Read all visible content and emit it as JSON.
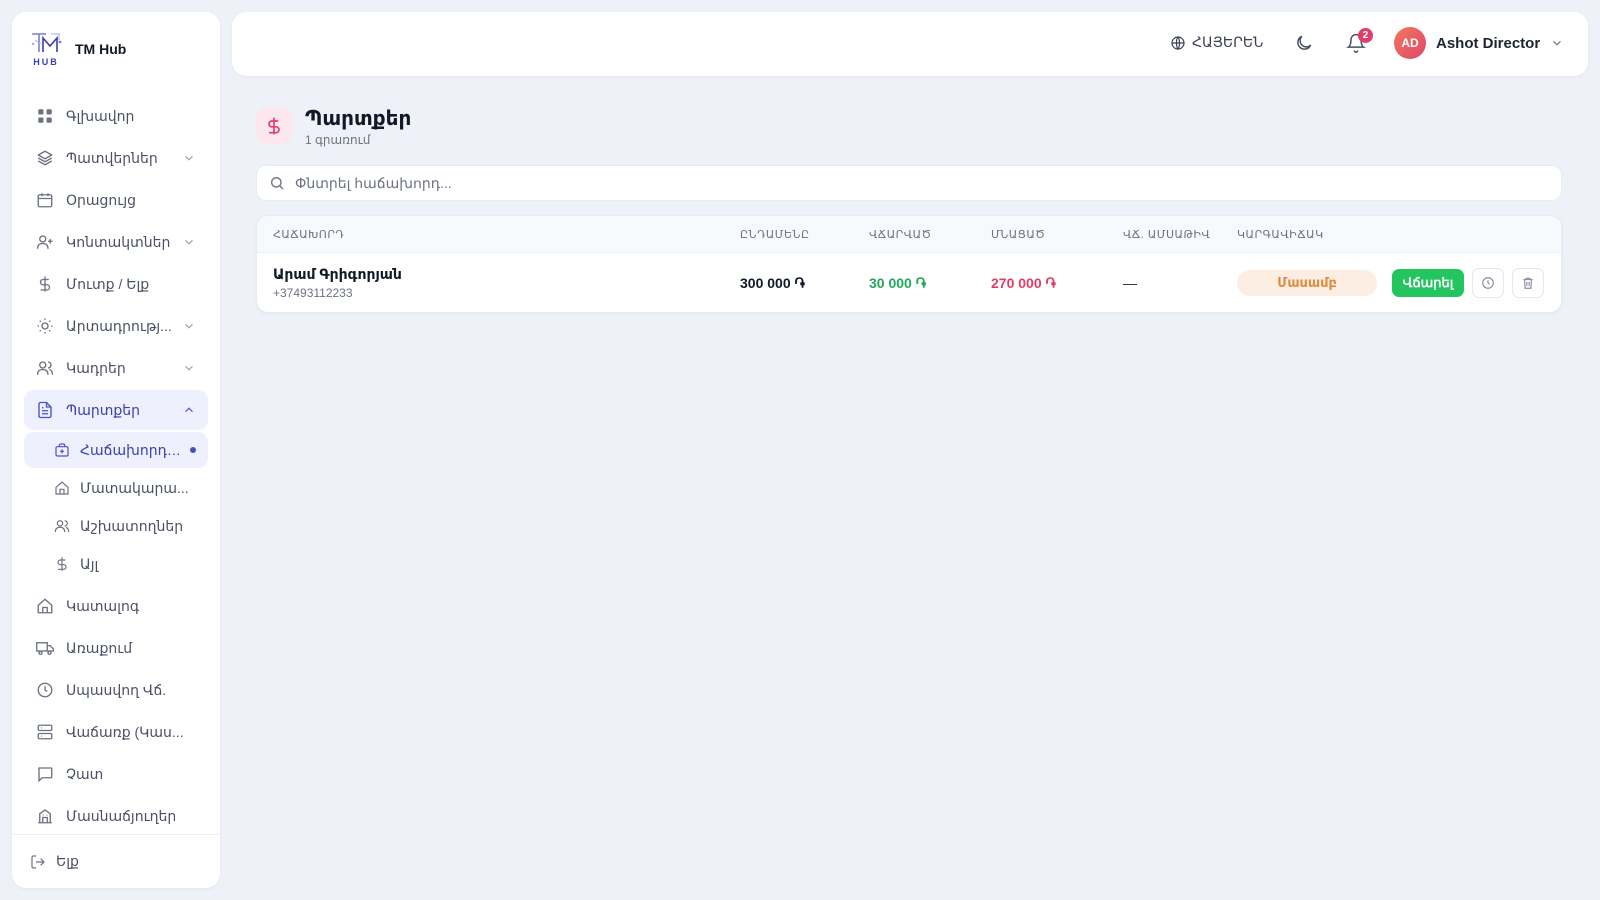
{
  "brand": {
    "logo_text": "HUB",
    "name": "TM Hub"
  },
  "sidebar": {
    "items": [
      {
        "label": "Գլխավոր",
        "icon": "grid-icon"
      },
      {
        "label": "Պատվերներ",
        "icon": "layers-icon"
      },
      {
        "label": "Օրացույց",
        "icon": "calendar-icon"
      },
      {
        "label": "Կոնտակտներ",
        "icon": "user-plus-icon"
      },
      {
        "label": "Մուտք / Ելք",
        "icon": "dollar-icon"
      },
      {
        "label": "Արտադրությ...",
        "icon": "sun-icon"
      },
      {
        "label": "Կադրեր",
        "icon": "users-icon"
      },
      {
        "label": "Պարտքեր",
        "icon": "document-icon"
      }
    ],
    "sub_items": [
      {
        "label": "Հաճախորդներ",
        "icon": "briefcase-icon"
      },
      {
        "label": "Մատակարա...",
        "icon": "home-icon"
      },
      {
        "label": "Աշխատողներ",
        "icon": "users-icon"
      },
      {
        "label": "Այլ",
        "icon": "dollar-icon"
      }
    ],
    "items_after": [
      {
        "label": "Կատալոգ",
        "icon": "home-icon"
      },
      {
        "label": "Առաքում",
        "icon": "truck-icon"
      },
      {
        "label": "Սպասվող Վճ.",
        "icon": "clock-icon"
      },
      {
        "label": "Վաճառք (Կաս...",
        "icon": "server-icon"
      },
      {
        "label": "Չատ",
        "icon": "chat-icon"
      },
      {
        "label": "Մասնաճյուղեր",
        "icon": "building-icon"
      }
    ],
    "logout": "Ելք"
  },
  "topbar": {
    "language": "ՀԱՅԵՐԵՆ",
    "notifications_count": "2",
    "user_initials": "AD",
    "user_name": "Ashot Director"
  },
  "page": {
    "title": "Պարտքեր",
    "subtitle": "1 գրառում"
  },
  "search": {
    "placeholder": "Փնտրել հաճախորդ...",
    "value": ""
  },
  "table": {
    "headers": [
      "ՀԱՃԱԽՈՐԴ",
      "ԸՆԴԱՄԵՆԸ",
      "ՎՃԱՐՎԱԾ",
      "ՄՆԱՑԱԾ",
      "ՎՃ. ԱՄՍԱԹԻՎ",
      "ԿԱՐԳԱՎԻՃԱԿ"
    ],
    "rows": [
      {
        "customer": "Արամ Գրիգորյան",
        "phone": "+37493112233",
        "total": "300 000 ֏",
        "paid": "30 000 ֏",
        "remaining": "270 000 ֏",
        "due_date": "—",
        "status": "Մասամբ",
        "pay_label": "Վճարել"
      }
    ]
  },
  "colors": {
    "accent": "#4b4fc4",
    "paid": "#22a85a",
    "remaining": "#e03e6a",
    "pay_button": "#22c55e",
    "status_partial": "#e08a3c"
  }
}
